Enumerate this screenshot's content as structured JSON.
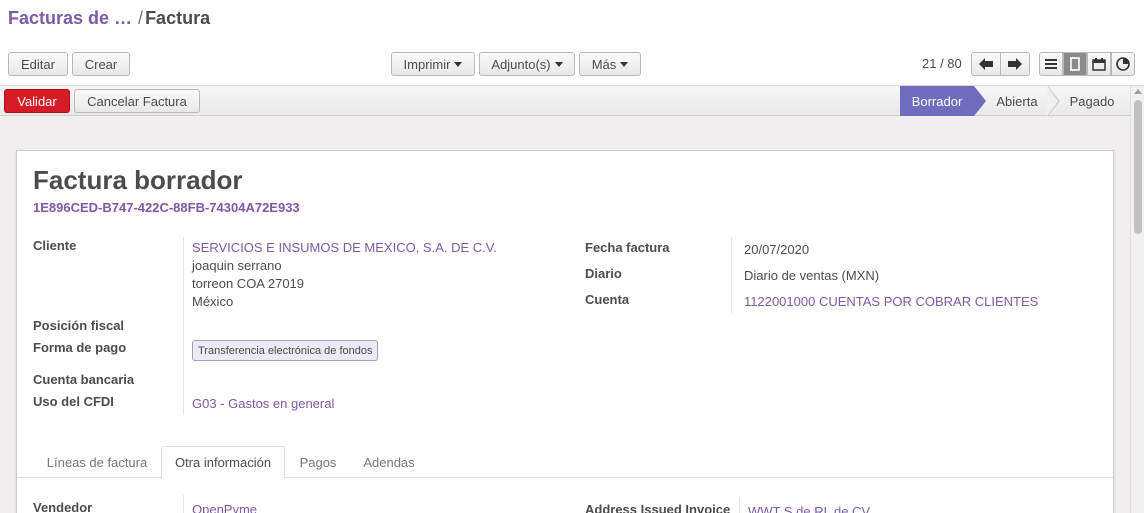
{
  "breadcrumb": {
    "parent": "Facturas de …",
    "separator": "/",
    "current": "Factura"
  },
  "toolbar": {
    "edit": "Editar",
    "create": "Crear",
    "print": "Imprimir",
    "attachments": "Adjunto(s)",
    "more": "Más"
  },
  "pager": {
    "value": "21 / 80"
  },
  "statusbar": {
    "validate": "Validar",
    "cancel": "Cancelar Factura",
    "stages": [
      "Borrador",
      "Abierta",
      "Pagado"
    ],
    "active_stage": "Borrador"
  },
  "invoice": {
    "title": "Factura borrador",
    "uuid": "1E896CED-B747-422C-88FB-74304A72E933",
    "client_label": "Cliente",
    "client_name": "SERVICIOS E INSUMOS DE MEXICO, S.A. DE C.V.",
    "client_contact": "joaquin serrano",
    "client_city": "torreon COA 27019",
    "client_country": "México",
    "fiscal_position_label": "Posición fiscal",
    "payment_form_label": "Forma de pago",
    "payment_form_value": "Transferencia electrónica de fondos",
    "bank_account_label": "Cuenta bancaria",
    "cfdi_use_label": "Uso del CFDI",
    "cfdi_use_value": "G03 - Gastos en general",
    "date_label": "Fecha factura",
    "date_value": "20/07/2020",
    "journal_label": "Diario",
    "journal_value": "Diario de ventas (MXN)",
    "account_label": "Cuenta",
    "account_value": "1122001000 CUENTAS POR COBRAR CLIENTES"
  },
  "tabs": [
    "Líneas de factura",
    "Otra información",
    "Pagos",
    "Adendas"
  ],
  "active_tab": "Otra información",
  "other_info": {
    "seller_label": "Vendedor",
    "seller_value": "OpenPyme",
    "address_label": "Address Issued Invoice",
    "address_value": "WWT S de RL de CV"
  },
  "colors": {
    "link": "#7c5aa6",
    "primary": "#d51c26",
    "active_stage": "#6f6bbf"
  }
}
